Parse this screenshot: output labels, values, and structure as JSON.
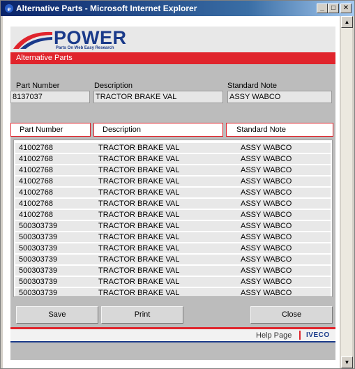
{
  "window": {
    "title": "Alternative Parts - Microsoft Internet Explorer",
    "minimize": "_",
    "maximize": "□",
    "close": "✕"
  },
  "logo": {
    "name": "POWER",
    "tagline": "Parts On Web Easy Research"
  },
  "section_title": "Alternative Parts",
  "header": {
    "part_number_label": "Part Number",
    "description_label": "Description",
    "standard_note_label": "Standard Note",
    "part_number": "8137037",
    "description": "TRACTOR BRAKE VAL",
    "standard_note": "ASSY WABCO"
  },
  "columns": [
    "Part Number",
    "Description",
    "Standard Note"
  ],
  "rows": [
    [
      "41002768",
      "TRACTOR BRAKE VAL",
      "ASSY WABCO"
    ],
    [
      "41002768",
      "TRACTOR BRAKE VAL",
      "ASSY WABCO"
    ],
    [
      "41002768",
      "TRACTOR BRAKE VAL",
      "ASSY WABCO"
    ],
    [
      "41002768",
      "TRACTOR BRAKE VAL",
      "ASSY WABCO"
    ],
    [
      "41002768",
      "TRACTOR BRAKE VAL",
      "ASSY WABCO"
    ],
    [
      "41002768",
      "TRACTOR BRAKE VAL",
      "ASSY WABCO"
    ],
    [
      "41002768",
      "TRACTOR BRAKE VAL",
      "ASSY WABCO"
    ],
    [
      "500303739",
      "TRACTOR BRAKE VAL",
      "ASSY WABCO"
    ],
    [
      "500303739",
      "TRACTOR BRAKE VAL",
      "ASSY WABCO"
    ],
    [
      "500303739",
      "TRACTOR BRAKE VAL",
      "ASSY WABCO"
    ],
    [
      "500303739",
      "TRACTOR BRAKE VAL",
      "ASSY WABCO"
    ],
    [
      "500303739",
      "TRACTOR BRAKE VAL",
      "ASSY WABCO"
    ],
    [
      "500303739",
      "TRACTOR BRAKE VAL",
      "ASSY WABCO"
    ],
    [
      "500303739",
      "TRACTOR BRAKE VAL",
      "ASSY WABCO"
    ]
  ],
  "buttons": {
    "save": "Save",
    "print": "Print",
    "close": "Close"
  },
  "footer": {
    "help": "Help Page",
    "brand": "IVECO"
  },
  "colors": {
    "accent_red": "#e0242c",
    "brand_blue": "#1a3a8a"
  }
}
